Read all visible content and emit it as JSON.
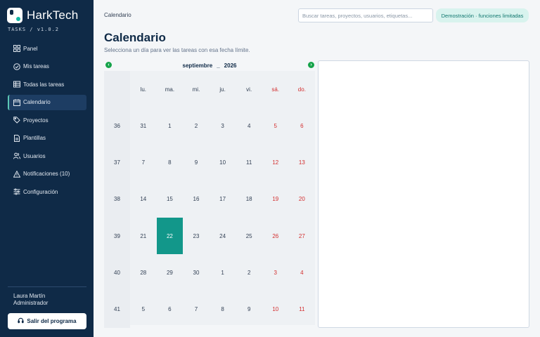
{
  "brand": {
    "name": "HarkTech",
    "version": "TASKS / v1.0.2"
  },
  "sidebar": {
    "items": [
      {
        "label": "Panel",
        "icon": "grid-icon"
      },
      {
        "label": "Mis tareas",
        "icon": "check-circle-icon"
      },
      {
        "label": "Todas las tareas",
        "icon": "table-icon"
      },
      {
        "label": "Calendario",
        "icon": "calendar-icon",
        "active": true
      },
      {
        "label": "Proyectos",
        "icon": "tags-icon"
      },
      {
        "label": "Plantillas",
        "icon": "document-icon"
      },
      {
        "label": "Usuarios",
        "icon": "users-icon"
      },
      {
        "label": "Notificaciones  (10)",
        "icon": "warning-icon"
      },
      {
        "label": "Configuración",
        "icon": "sliders-icon"
      }
    ],
    "user": {
      "name": "Laura Martín",
      "role": "Administrador"
    },
    "logout_label": "Salir del programa"
  },
  "topbar": {
    "breadcrumb": "Calendario",
    "search_placeholder": "Buscar tareas, proyectos, usuarios, etiquetas...",
    "demo_badge": "Demostración · funciones limitadas"
  },
  "page": {
    "title": "Calendario",
    "subtitle": "Selecciona un día para ver las tareas con esa fecha límite."
  },
  "calendar": {
    "month": "septiembre",
    "separator": "_",
    "year": "2026",
    "weekdays": [
      "lu.",
      "ma.",
      "mi.",
      "ju.",
      "vi.",
      "sá.",
      "do."
    ],
    "weeks": [
      {
        "num": "36",
        "days": [
          "31",
          "1",
          "2",
          "3",
          "4",
          "5",
          "6"
        ]
      },
      {
        "num": "37",
        "days": [
          "7",
          "8",
          "9",
          "10",
          "11",
          "12",
          "13"
        ]
      },
      {
        "num": "38",
        "days": [
          "14",
          "15",
          "16",
          "17",
          "18",
          "19",
          "20"
        ]
      },
      {
        "num": "39",
        "days": [
          "21",
          "22",
          "23",
          "24",
          "25",
          "26",
          "27"
        ]
      },
      {
        "num": "40",
        "days": [
          "28",
          "29",
          "30",
          "1",
          "2",
          "3",
          "4"
        ]
      },
      {
        "num": "41",
        "days": [
          "5",
          "6",
          "7",
          "8",
          "9",
          "10",
          "11"
        ]
      }
    ],
    "selected": {
      "week": 3,
      "day": 1
    },
    "colors": {
      "selected": "#12978a",
      "weekend": "#d32f2f",
      "nav_arrow": "#16a34a"
    }
  }
}
